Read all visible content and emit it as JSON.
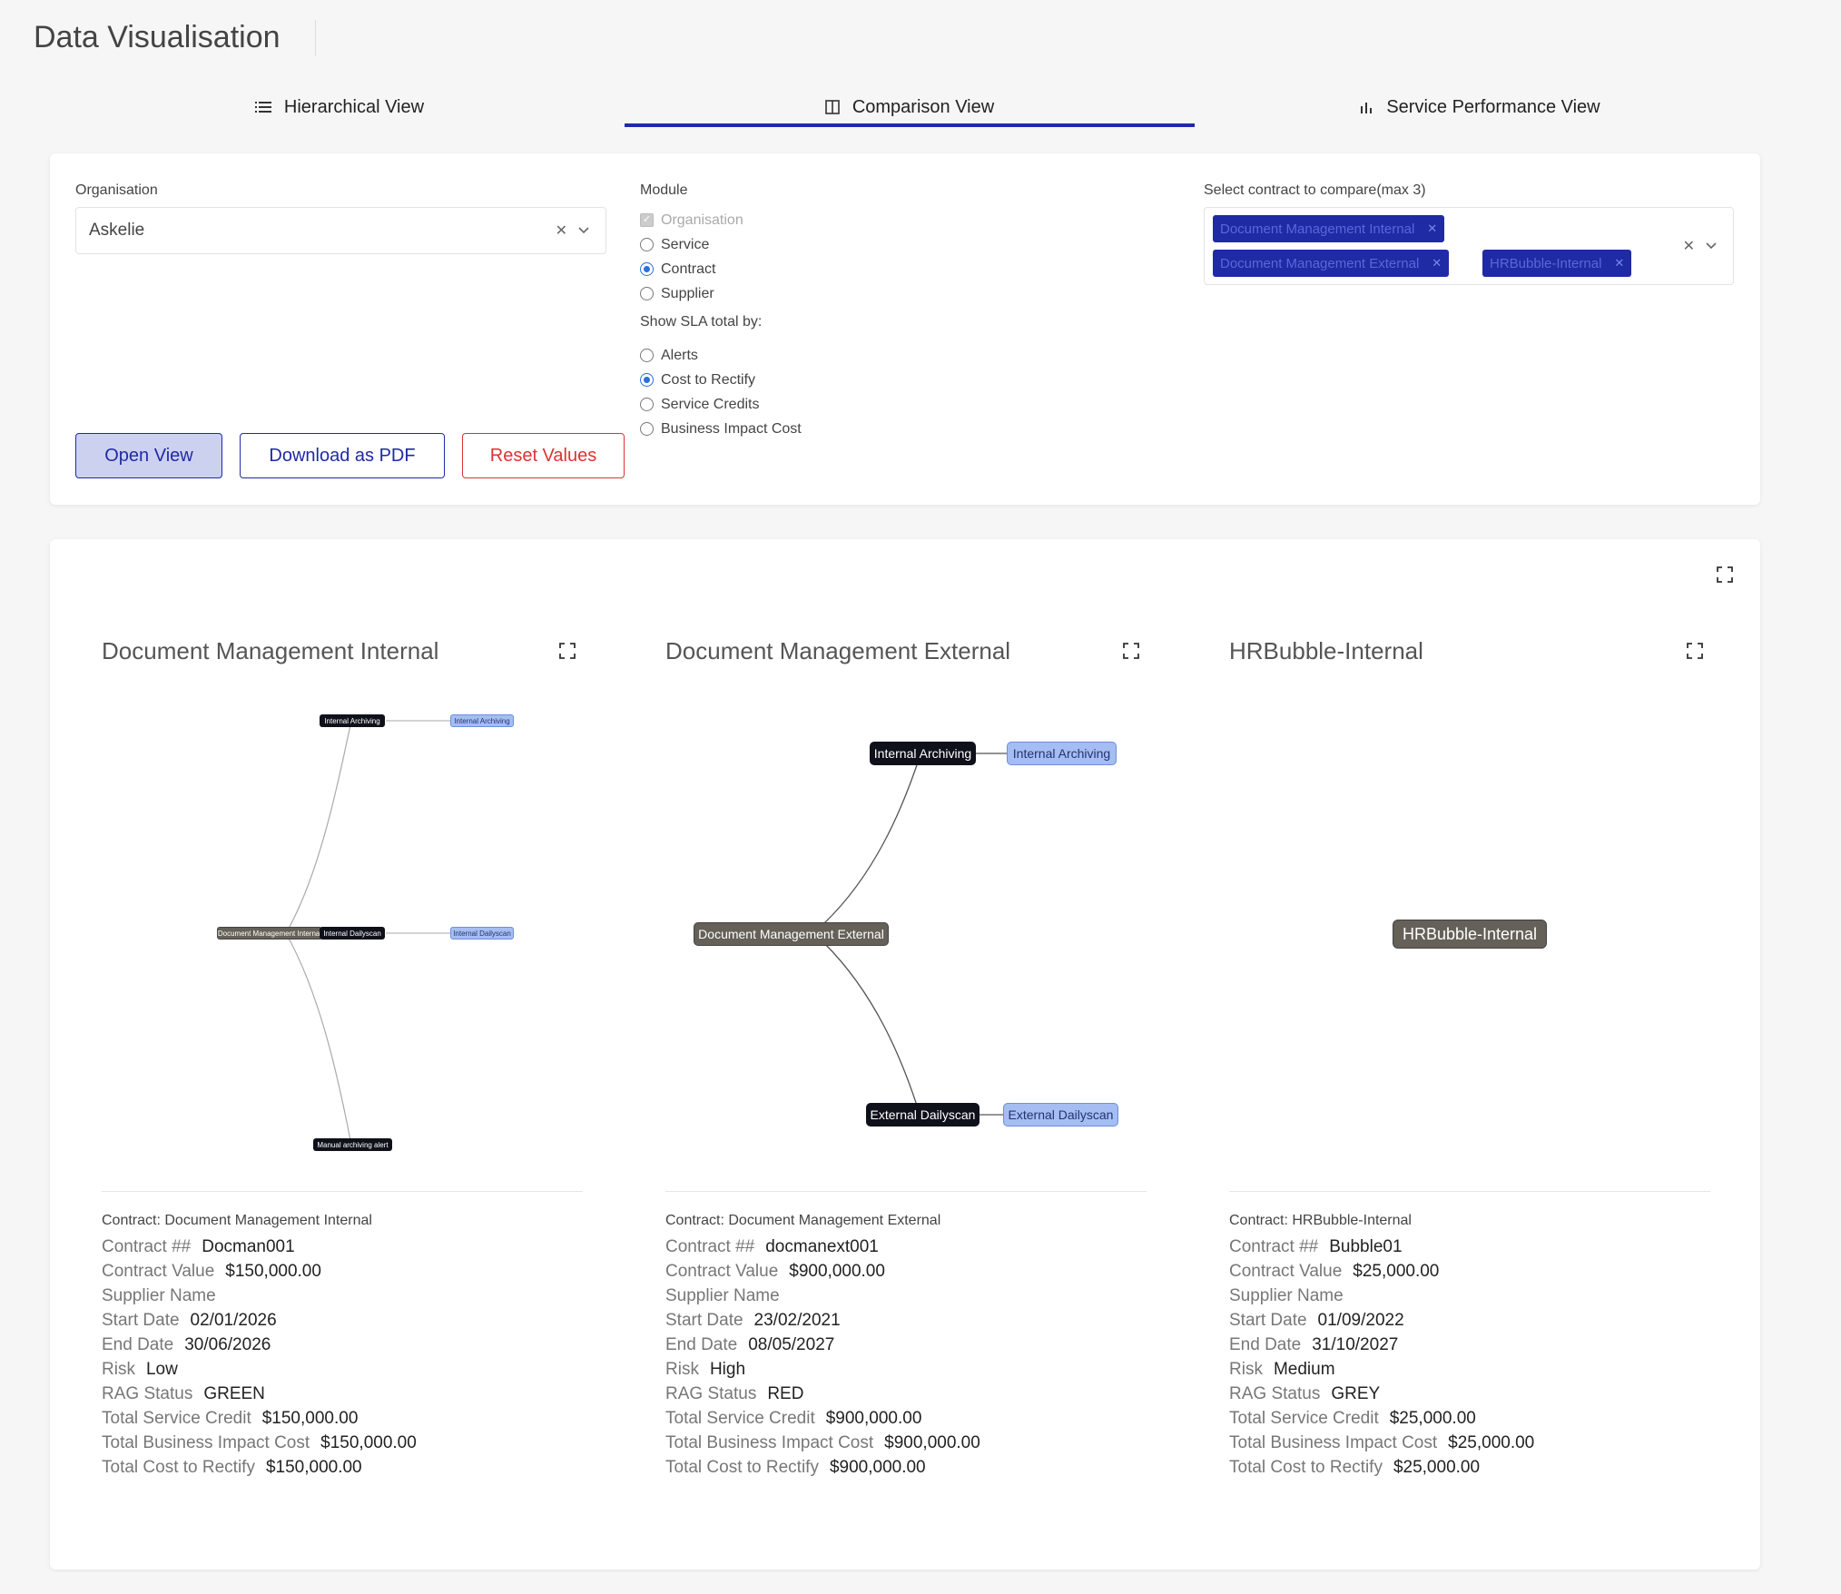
{
  "page": {
    "title": "Data Visualisation"
  },
  "tabs": [
    {
      "label": "Hierarchical View",
      "icon": "list-icon"
    },
    {
      "label": "Comparison View",
      "icon": "columns-icon"
    },
    {
      "label": "Service Performance View",
      "icon": "bar-chart-icon"
    }
  ],
  "filters": {
    "organisation_label": "Organisation",
    "organisation_value": "Askelie",
    "module_label": "Module",
    "module_options": [
      "Organisation",
      "Service",
      "Contract",
      "Supplier"
    ],
    "module_selected": "Contract",
    "sla_label": "Show SLA total by:",
    "sla_options": [
      "Alerts",
      "Cost to Rectify",
      "Service Credits",
      "Business Impact Cost"
    ],
    "sla_selected": "Cost to Rectify",
    "contract_label": "Select contract to compare(max 3)",
    "contract_chips": [
      "Document Management Internal",
      "Document Management External",
      "HRBubble-Internal"
    ]
  },
  "buttons": {
    "open_view": "Open View",
    "download_pdf": "Download as PDF",
    "reset_values": "Reset Values"
  },
  "panels": [
    {
      "title": "Document Management Internal",
      "graph": {
        "root": "Document Management Internal",
        "children": [
          {
            "label": "Internal Archiving",
            "leaf": "Internal Archiving"
          },
          {
            "label": "Internal Dailyscan",
            "leaf": "Internal Dailyscan"
          },
          {
            "label": "Manual archiving alert"
          }
        ]
      },
      "contract_heading": "Contract: Document Management Internal",
      "details": [
        {
          "key": "Contract ##",
          "value": "Docman001"
        },
        {
          "key": "Contract Value",
          "value": "$150,000.00"
        },
        {
          "key": "Supplier Name",
          "value": ""
        },
        {
          "key": "Start Date",
          "value": "02/01/2026"
        },
        {
          "key": "End Date",
          "value": "30/06/2026"
        },
        {
          "key": "Risk",
          "value": "Low"
        },
        {
          "key": "RAG Status",
          "value": "GREEN"
        },
        {
          "key": "Total Service Credit",
          "value": "$150,000.00"
        },
        {
          "key": "Total Business Impact Cost",
          "value": "$150,000.00"
        },
        {
          "key": "Total Cost to Rectify",
          "value": "$150,000.00"
        }
      ]
    },
    {
      "title": "Document Management External",
      "graph": {
        "root": "Document Management External",
        "children": [
          {
            "label": "Internal Archiving",
            "leaf": "Internal Archiving"
          },
          {
            "label": "External Dailyscan",
            "leaf": "External Dailyscan"
          }
        ]
      },
      "contract_heading": "Contract: Document Management External",
      "details": [
        {
          "key": "Contract ##",
          "value": "docmanext001"
        },
        {
          "key": "Contract Value",
          "value": "$900,000.00"
        },
        {
          "key": "Supplier Name",
          "value": ""
        },
        {
          "key": "Start Date",
          "value": "23/02/2021"
        },
        {
          "key": "End Date",
          "value": "08/05/2027"
        },
        {
          "key": "Risk",
          "value": "High"
        },
        {
          "key": "RAG Status",
          "value": "RED"
        },
        {
          "key": "Total Service Credit",
          "value": "$900,000.00"
        },
        {
          "key": "Total Business Impact Cost",
          "value": "$900,000.00"
        },
        {
          "key": "Total Cost to Rectify",
          "value": "$900,000.00"
        }
      ]
    },
    {
      "title": "HRBubble-Internal",
      "graph": {
        "root": "HRBubble-Internal",
        "children": []
      },
      "contract_heading": "Contract: HRBubble-Internal",
      "details": [
        {
          "key": "Contract ##",
          "value": "Bubble01"
        },
        {
          "key": "Contract Value",
          "value": "$25,000.00"
        },
        {
          "key": "Supplier Name",
          "value": ""
        },
        {
          "key": "Start Date",
          "value": "01/09/2022"
        },
        {
          "key": "End Date",
          "value": "31/10/2027"
        },
        {
          "key": "Risk",
          "value": "Medium"
        },
        {
          "key": "RAG Status",
          "value": "GREY"
        },
        {
          "key": "Total Service Credit",
          "value": "$25,000.00"
        },
        {
          "key": "Total Business Impact Cost",
          "value": "$25,000.00"
        },
        {
          "key": "Total Cost to Rectify",
          "value": "$25,000.00"
        }
      ]
    }
  ],
  "colors": {
    "accent": "#1f2aa5",
    "danger": "#dd3333",
    "node_dark": "#0e111a",
    "node_light": "#a4bdf2",
    "node_root": "#656058"
  }
}
